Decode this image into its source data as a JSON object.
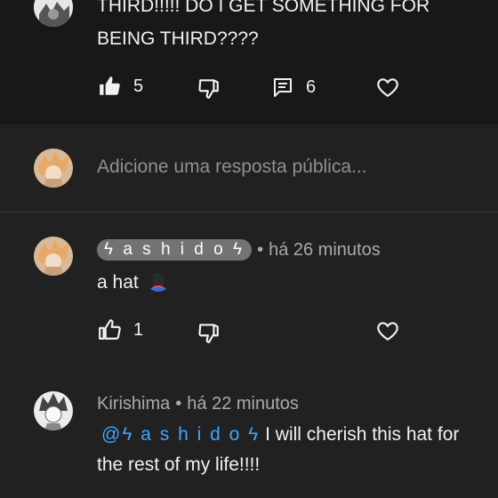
{
  "comments": [
    {
      "text_lines": [
        "THIRD!!!!! DO I GET SOMETHING FOR",
        "BEING THIRD????"
      ],
      "likes": "5",
      "replies": "6"
    },
    {
      "author": "ϟ a s h i d o ϟ",
      "time": "há 26 minutos",
      "text": "a hat",
      "likes": "1"
    },
    {
      "author": "Kirishima",
      "time": "há 22 minutos",
      "mention": "@ϟ a s h i d o ϟ",
      "text_line1": " I will cherish this hat for",
      "text_line2": "the rest of my life!!!!"
    }
  ],
  "reply_box": {
    "placeholder": "Adicione uma resposta pública..."
  },
  "meta_separator": "•",
  "colors": {
    "background": "#212121",
    "highlight_block": "#181818",
    "mention": "#3ea6ff",
    "name_chip": "#737373"
  },
  "icons": [
    "like-icon-filled",
    "dislike-icon",
    "reply-icon",
    "heart-icon",
    "like-icon-outline"
  ]
}
